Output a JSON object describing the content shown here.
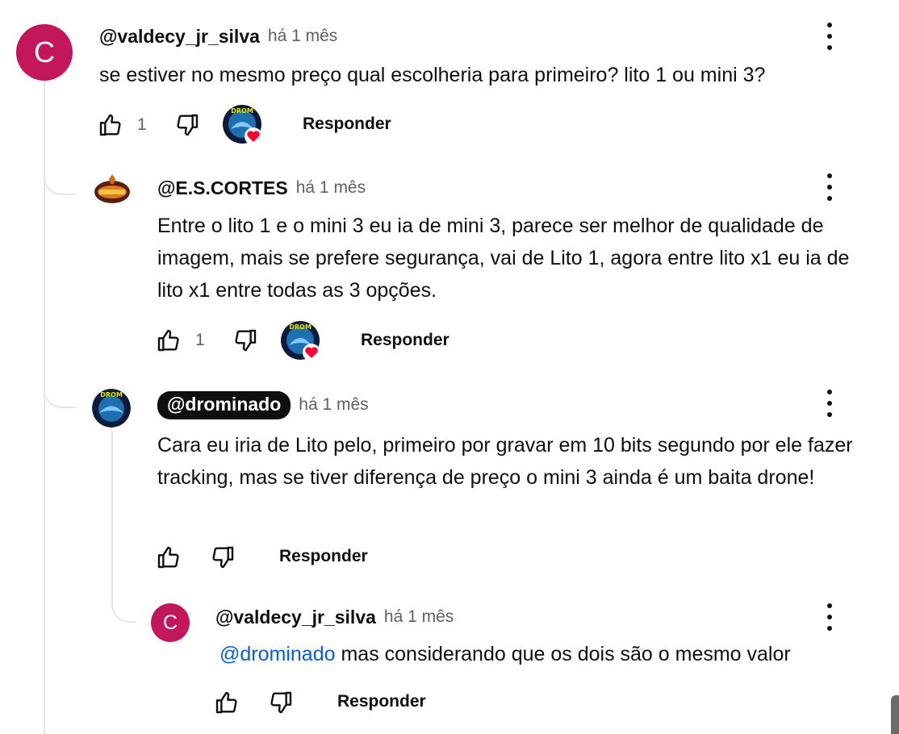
{
  "comments": [
    {
      "avatar_letter": "C",
      "avatar_color": "#c2185b",
      "handle": "@valdecy_jr_silva",
      "time": "há 1 mês",
      "text": "se estiver no mesmo preço qual escolheria para primeiro? lito 1 ou mini 3?",
      "likes": "1",
      "reply_label": "Responder",
      "creator_heart": true
    },
    {
      "avatar_image": "escortes-logo",
      "handle": "@E.S.CORTES",
      "time": "há 1 mês",
      "text": "Entre o lito 1 e o mini 3 eu ia de mini 3, parece ser melhor de qualidade de imagem, mais se prefere segurança, vai de Lito 1, agora entre lito x1 eu ia de lito x1 entre todas as 3 opções.",
      "likes": "1",
      "reply_label": "Responder",
      "creator_heart": true
    },
    {
      "avatar_image": "drominado-logo",
      "handle": "@drominado",
      "is_creator": true,
      "time": "há 1 mês",
      "text": "Cara eu iria de Lito pelo, primeiro por gravar em 10 bits segundo por ele fazer tracking, mas se tiver diferença de preço o mini 3 ainda é um baita drone!",
      "reply_label": "Responder"
    },
    {
      "avatar_letter": "C",
      "avatar_color": "#c2185b",
      "handle": "@valdecy_jr_silva",
      "time": "há 1 mês",
      "mention": "@drominado",
      "text": "mas considerando que os dois são o mesmo valor",
      "reply_label": "Responder"
    }
  ],
  "colors": {
    "text": "#0f0f0f",
    "secondary": "#606060",
    "mention": "#065fd4",
    "heart": "#ff0033",
    "thread_line": "#e5e5e5"
  },
  "icons": [
    "thumb-up-icon",
    "thumb-down-icon",
    "more-vert-icon",
    "heart-icon"
  ]
}
